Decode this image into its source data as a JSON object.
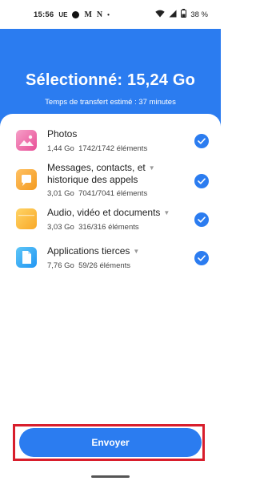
{
  "status_bar": {
    "time": "15:56",
    "carrier": "UE",
    "app_glyph_1": "M",
    "app_glyph_2": "N",
    "more_dot": "•",
    "battery": "38 %"
  },
  "header": {
    "title": "Sélectionné: 15,24 Go",
    "subtitle": "Temps de transfert estimé : 37 minutes",
    "background": "#2b7cf0"
  },
  "items": [
    {
      "title": "Photos",
      "size": "1,44 Go",
      "count": "1742/1742 éléments",
      "icon": "photos-icon",
      "checked": true
    },
    {
      "title_line1": "Messages, contacts, et",
      "title_line2": "historique des appels",
      "size": "3,01 Go",
      "count": "7041/7041 éléments",
      "icon": "messages-icon",
      "checked": true
    },
    {
      "title": "Audio, vidéo et documents",
      "size": "3,03 Go",
      "count": "316/316 éléments",
      "icon": "folder-icon",
      "checked": true
    },
    {
      "title": "Applications tierces",
      "size": "7,76 Go",
      "count": "59/26 éléments",
      "icon": "applications-icon",
      "checked": true
    }
  ],
  "send_button": {
    "label": "Envoyer"
  },
  "colors": {
    "accent": "#2b7cf0",
    "highlight_frame": "#d81e2c"
  }
}
